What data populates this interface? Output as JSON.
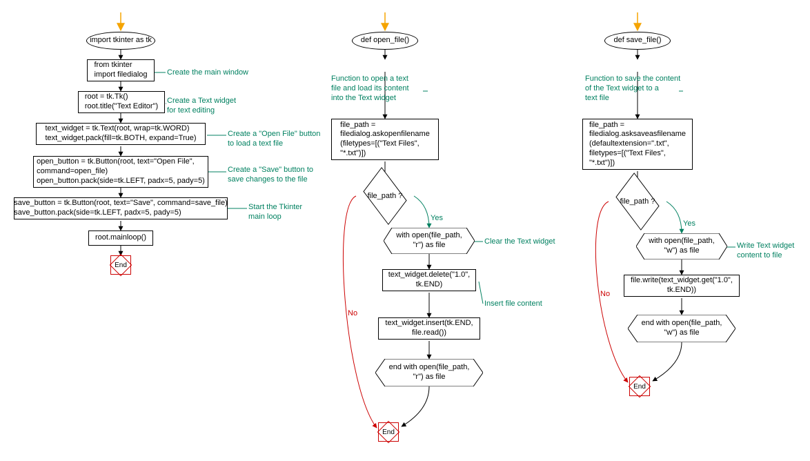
{
  "col1": {
    "n1": "import tkinter as tk",
    "n2": "from tkinter\nimport filedialog",
    "n3": "root = tk.Tk()\nroot.title(\"Text Editor\")",
    "n4": "text_widget = tk.Text(root, wrap=tk.WORD)\ntext_widget.pack(fill=tk.BOTH, expand=True)",
    "n5": "open_button = tk.Button(root, text=\"Open File\",\ncommand=open_file)\nopen_button.pack(side=tk.LEFT, padx=5, pady=5)",
    "n6": "save_button = tk.Button(root, text=\"Save\", command=save_file)\nsave_button.pack(side=tk.LEFT, padx=5, pady=5)",
    "n7": "root.mainloop()",
    "a1": "Create the main window",
    "a2": "Create a Text widget\nfor text editing",
    "a3": "Create a \"Open File\" button\nto load a text file",
    "a4": "Create a \"Save\" button to\nsave changes to the file",
    "a5": "Start the Tkinter\nmain loop",
    "end": "End"
  },
  "col2": {
    "n1": "def open_file()",
    "a1": "Function to open a text\nfile and load its content\ninto the Text widget",
    "n2": "file_path =\nfiledialog.askopenfilename\n(filetypes=[(\"Text Files\",\n\"*.txt\")])",
    "dec": "file_path ?",
    "n3": "with open(file_path,\n\"r\") as file",
    "a2": "Clear the Text widget",
    "n4": "text_widget.delete(\"1.0\",\ntk.END)",
    "a3": "Insert file content",
    "n5": "text_widget.insert(tk.END,\nfile.read())",
    "n6": "end with open(file_path,\n\"r\") as file",
    "yes": "Yes",
    "no": "No",
    "end": "End"
  },
  "col3": {
    "n1": "def save_file()",
    "a1": "Function to save the content\nof the Text widget to a\ntext file",
    "n2": "file_path =\nfiledialog.asksaveasfilename\n(defaultextension=\".txt\",\nfiletypes=[(\"Text Files\",\n\"*.txt\")])",
    "dec": "file_path ?",
    "n3": "with open(file_path,\n\"w\") as file",
    "a2": "Write Text widget\ncontent to file",
    "n4": "file.write(text_widget.get(\"1.0\",\ntk.END))",
    "n5": "end with open(file_path,\n\"w\") as file",
    "yes": "Yes",
    "no": "No",
    "end": "End"
  }
}
